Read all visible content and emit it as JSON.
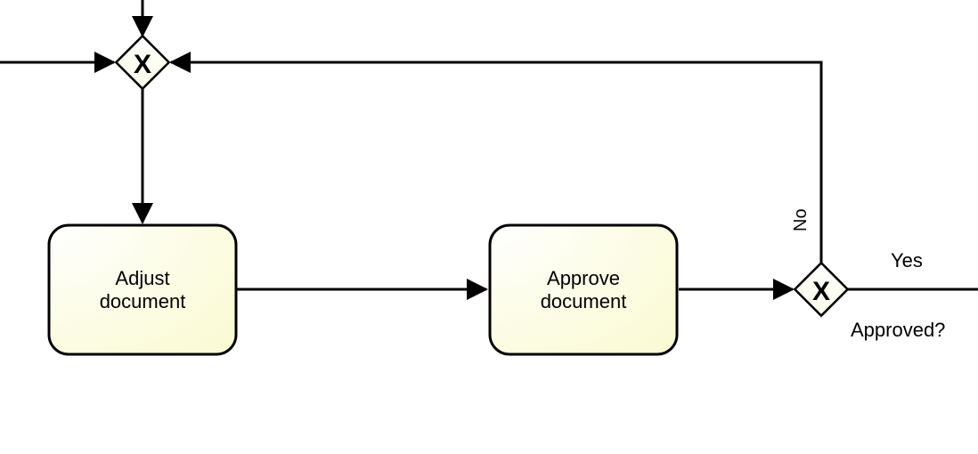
{
  "tasks": {
    "adjust": {
      "line1": "Adjust",
      "line2": "document"
    },
    "approve": {
      "line1": "Approve",
      "line2": "document"
    }
  },
  "gateways": {
    "merge": {
      "marker": "X"
    },
    "decision": {
      "marker": "X",
      "label": "Approved?"
    }
  },
  "edges": {
    "yes": "Yes",
    "no": "No"
  },
  "chart_data": {
    "type": "bpmn-flow",
    "nodes": [
      {
        "id": "g1",
        "type": "exclusive-gateway",
        "label": ""
      },
      {
        "id": "t1",
        "type": "task",
        "label": "Adjust document"
      },
      {
        "id": "t2",
        "type": "task",
        "label": "Approve document"
      },
      {
        "id": "g2",
        "type": "exclusive-gateway",
        "label": "Approved?"
      }
    ],
    "edges": [
      {
        "from": "incoming-top",
        "to": "g1"
      },
      {
        "from": "incoming-left",
        "to": "g1"
      },
      {
        "from": "g1",
        "to": "t1"
      },
      {
        "from": "t1",
        "to": "t2"
      },
      {
        "from": "t2",
        "to": "g2"
      },
      {
        "from": "g2",
        "to": "outgoing-right",
        "label": "Yes"
      },
      {
        "from": "g2",
        "to": "g1",
        "label": "No"
      }
    ]
  }
}
